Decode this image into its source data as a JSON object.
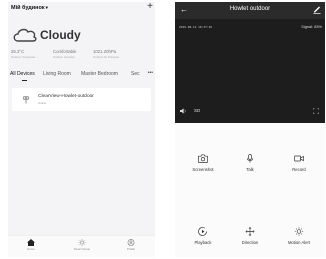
{
  "left": {
    "home_name": "Мій будинок",
    "weather": {
      "label": "Cloudy"
    },
    "stats": [
      {
        "value": "25.3°C",
        "label": "Outdoor Temperatu..."
      },
      {
        "value": "Comfortable",
        "label": "Outdoor Humidity"
      },
      {
        "value": "1021.20hPa",
        "label": "Outdoor Air Pressure"
      }
    ],
    "tabs": [
      "All Devices",
      "Living Room",
      "Master Bedroom",
      "Sec"
    ],
    "device": {
      "name": "ClearView-Howlet-outdoor",
      "status": "Online"
    },
    "nav": [
      "Home",
      "Smart Scene",
      "Profile"
    ]
  },
  "right": {
    "title": "Howlet outdoor",
    "timestamp": "2019-08-12 10:37:46",
    "signal": "Signal: 83%",
    "quality": "SD",
    "controls": [
      "Screenshot",
      "Talk",
      "Record",
      "Playback",
      "Direction",
      "Motion Alert"
    ]
  }
}
